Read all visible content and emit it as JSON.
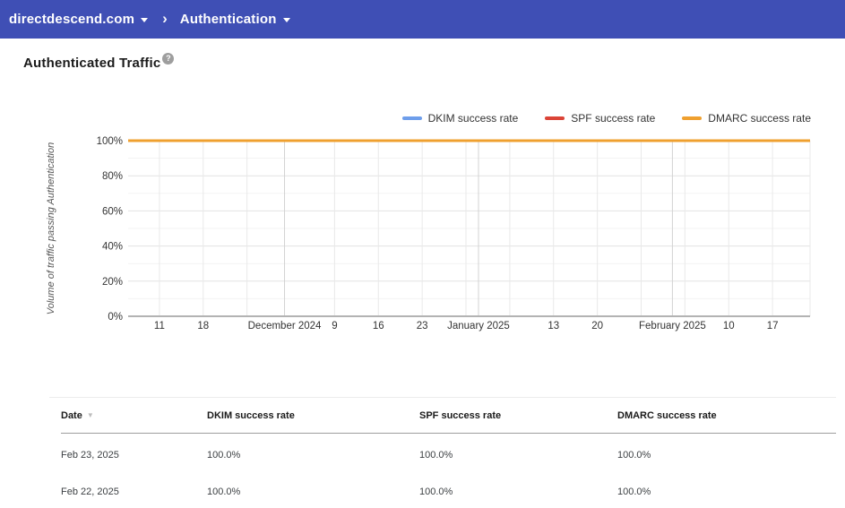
{
  "topbar": {
    "background_color": "#3f4fb5",
    "domain_menu": {
      "label": "directdescend.com"
    },
    "separator": "›",
    "section_menu": {
      "label": "Authentication"
    }
  },
  "page": {
    "title": "Authenticated Traffic",
    "help_icon": "question-mark-in-circle"
  },
  "chart_data": {
    "type": "line",
    "title": "Authenticated Traffic",
    "xlabel": "",
    "ylabel": "Volume of traffic passing Authentication",
    "ylim": [
      0,
      100
    ],
    "grid": true,
    "legend_position": "top-right",
    "y_ticks": [
      {
        "value": 0,
        "label": "0%"
      },
      {
        "value": 20,
        "label": "20%"
      },
      {
        "value": 40,
        "label": "40%"
      },
      {
        "value": 60,
        "label": "60%"
      },
      {
        "value": 80,
        "label": "80%"
      },
      {
        "value": 100,
        "label": "100%"
      }
    ],
    "y_minor_gridline_step": 10,
    "x_axis": {
      "min_day": -5,
      "max_day": 104
    },
    "x_ticks": [
      {
        "label": "11",
        "day": 0
      },
      {
        "label": "18",
        "day": 7
      },
      {
        "label": "December 2024",
        "day": 20
      },
      {
        "label": "9",
        "day": 28
      },
      {
        "label": "16",
        "day": 35
      },
      {
        "label": "23",
        "day": 42
      },
      {
        "label": "January 2025",
        "day": 51
      },
      {
        "label": "13",
        "day": 63
      },
      {
        "label": "20",
        "day": 70
      },
      {
        "label": "February 2025",
        "day": 82
      },
      {
        "label": "10",
        "day": 91
      },
      {
        "label": "17",
        "day": 98
      }
    ],
    "x_gridlines": {
      "weekly_days": [
        0,
        7,
        14,
        28,
        35,
        42,
        49,
        56,
        63,
        70,
        77,
        84,
        91,
        98,
        104
      ],
      "month_start_days": [
        20,
        51,
        82
      ]
    },
    "series": [
      {
        "name": "DKIM success rate",
        "color": "#6e9eeb",
        "constant_value_percent": 100
      },
      {
        "name": "SPF success rate",
        "color": "#db4437",
        "constant_value_percent": 100
      },
      {
        "name": "DMARC success rate",
        "color": "#efa02f",
        "constant_value_percent": 100
      }
    ]
  },
  "table": {
    "columns": [
      {
        "label": "Date",
        "sorted": true
      },
      {
        "label": "DKIM success rate"
      },
      {
        "label": "SPF success rate"
      },
      {
        "label": "DMARC success rate"
      }
    ],
    "sort_icon": "▼",
    "rows": [
      [
        "Feb 23, 2025",
        "100.0%",
        "100.0%",
        "100.0%"
      ],
      [
        "Feb 22, 2025",
        "100.0%",
        "100.0%",
        "100.0%"
      ]
    ]
  }
}
